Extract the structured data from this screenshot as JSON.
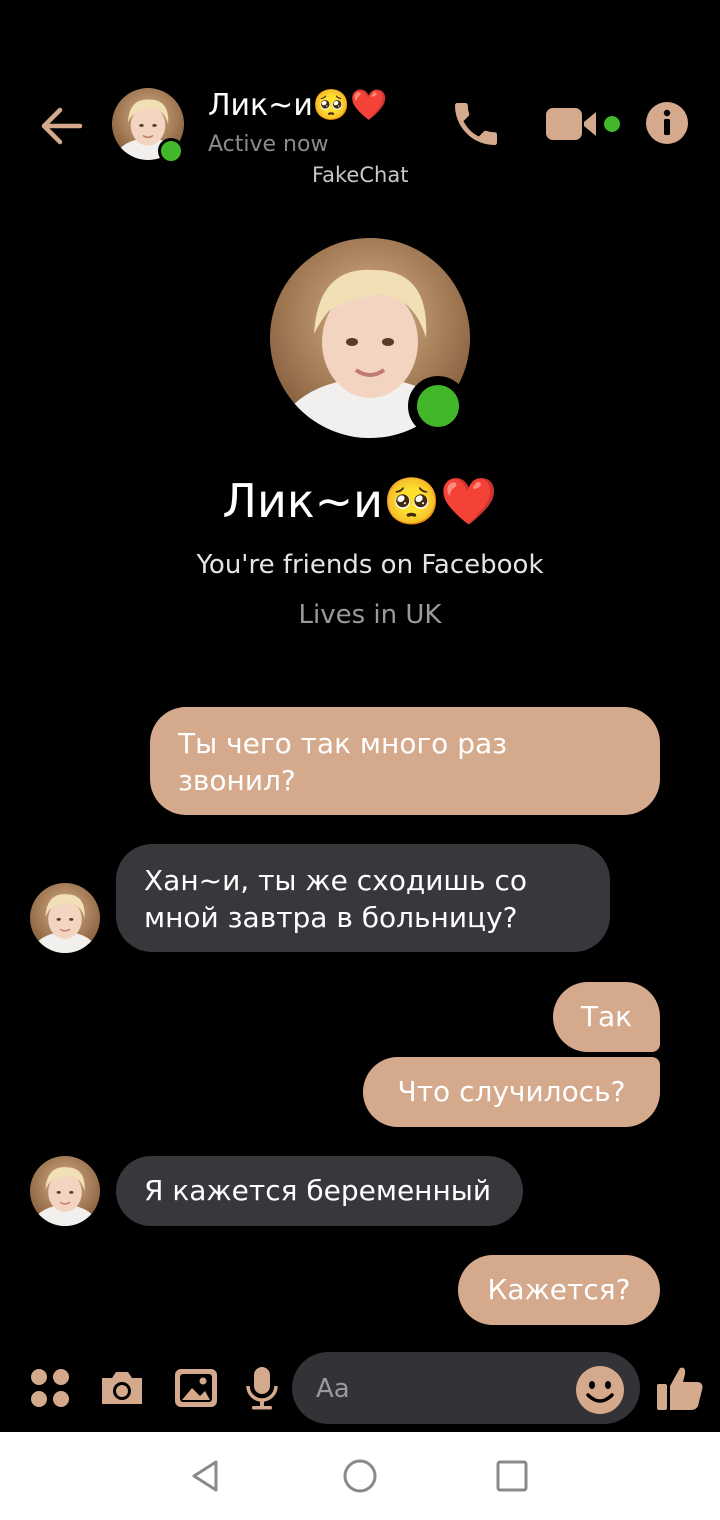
{
  "header": {
    "contact_name": "Лик~и🥺❤️",
    "status": "Active now",
    "watermark": "FakeChat"
  },
  "profile": {
    "name": "Лик~и🥺❤️",
    "friends_text": "You're friends on Facebook",
    "lives_text": "Lives in UK"
  },
  "messages": [
    {
      "direction": "outgoing",
      "lines": [
        "Ты чего так много раз",
        "звонил?"
      ]
    },
    {
      "direction": "incoming",
      "lines": [
        "Хан~и, ты же сходишь со",
        "мной завтра в больницу?"
      ]
    },
    {
      "direction": "outgoing",
      "lines": [
        "Так"
      ]
    },
    {
      "direction": "outgoing",
      "lines": [
        "Что случилось?"
      ]
    },
    {
      "direction": "incoming",
      "lines": [
        "Я кажется беременный"
      ]
    },
    {
      "direction": "outgoing",
      "lines": [
        "Кажется?"
      ]
    }
  ],
  "composer": {
    "placeholder": "Aa"
  },
  "colors": {
    "accent": "#d5a98c",
    "online": "#42b72a",
    "incoming_bubble": "#38373c",
    "background": "#000000"
  },
  "icons": [
    "back-arrow-icon",
    "phone-icon",
    "video-camera-icon",
    "info-icon",
    "apps-grid-icon",
    "camera-icon",
    "gallery-icon",
    "microphone-icon",
    "emoji-icon",
    "thumbs-up-icon",
    "nav-back-icon",
    "nav-home-icon",
    "nav-recents-icon"
  ]
}
